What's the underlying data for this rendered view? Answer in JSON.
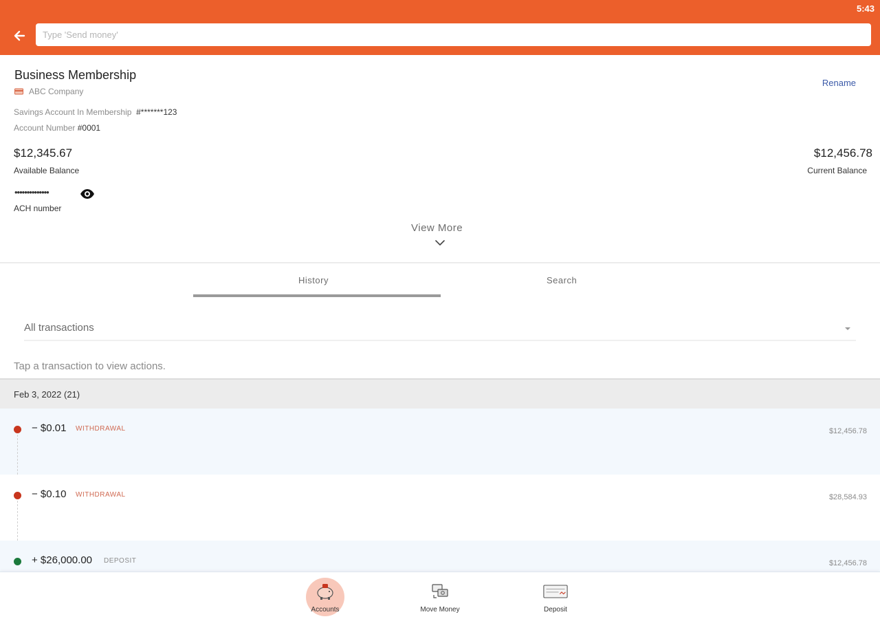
{
  "status_bar": {
    "time": "5:43"
  },
  "header": {
    "search_placeholder": "Type 'Send money'",
    "search_value": ""
  },
  "account": {
    "title": "Business Membership",
    "company": "ABC Company",
    "rename_label": "Rename",
    "savings_label": "Savings Account In Membership",
    "savings_number": "#*******123",
    "account_number_label": "Account Number",
    "account_number": "#0001",
    "available_balance": "$12,345.67",
    "available_balance_label": "Available Balance",
    "current_balance": "$12,456.78",
    "current_balance_label": "Current Balance",
    "ach_masked": "••••••••••••••",
    "ach_label": "ACH number",
    "view_more": "View More"
  },
  "tabs": [
    {
      "label": "History",
      "active": true
    },
    {
      "label": "Search",
      "active": false
    }
  ],
  "filter": {
    "selected": "All transactions"
  },
  "hint": "Tap a transaction to view actions.",
  "date_group": "Feb 3, 2022 (21)",
  "transactions": [
    {
      "amount": "− $0.01",
      "type": "WITHDRAWAL",
      "balance": "$12,456.78",
      "status_color": "#c8361e",
      "type_color": "#d06a52"
    },
    {
      "amount": "− $0.10",
      "type": "WITHDRAWAL",
      "balance": "$28,584.93",
      "status_color": "#c8361e",
      "type_color": "#d06a52"
    },
    {
      "amount": "+ $26,000.00",
      "type": "DEPOSIT",
      "balance": "$12,456.78",
      "status_color": "#1b7a3c",
      "type_color": "#8c8c8c"
    }
  ],
  "bottom_nav": [
    {
      "label": "Accounts",
      "icon": "piggy-bank-icon",
      "active": true
    },
    {
      "label": "Move Money",
      "icon": "money-transfer-icon",
      "active": false
    },
    {
      "label": "Deposit",
      "icon": "check-deposit-icon",
      "active": false
    }
  ],
  "colors": {
    "brand": "#ec5f2b",
    "link": "#3b5aa8",
    "withdrawal": "#c8361e",
    "deposit": "#1b7a3c"
  }
}
